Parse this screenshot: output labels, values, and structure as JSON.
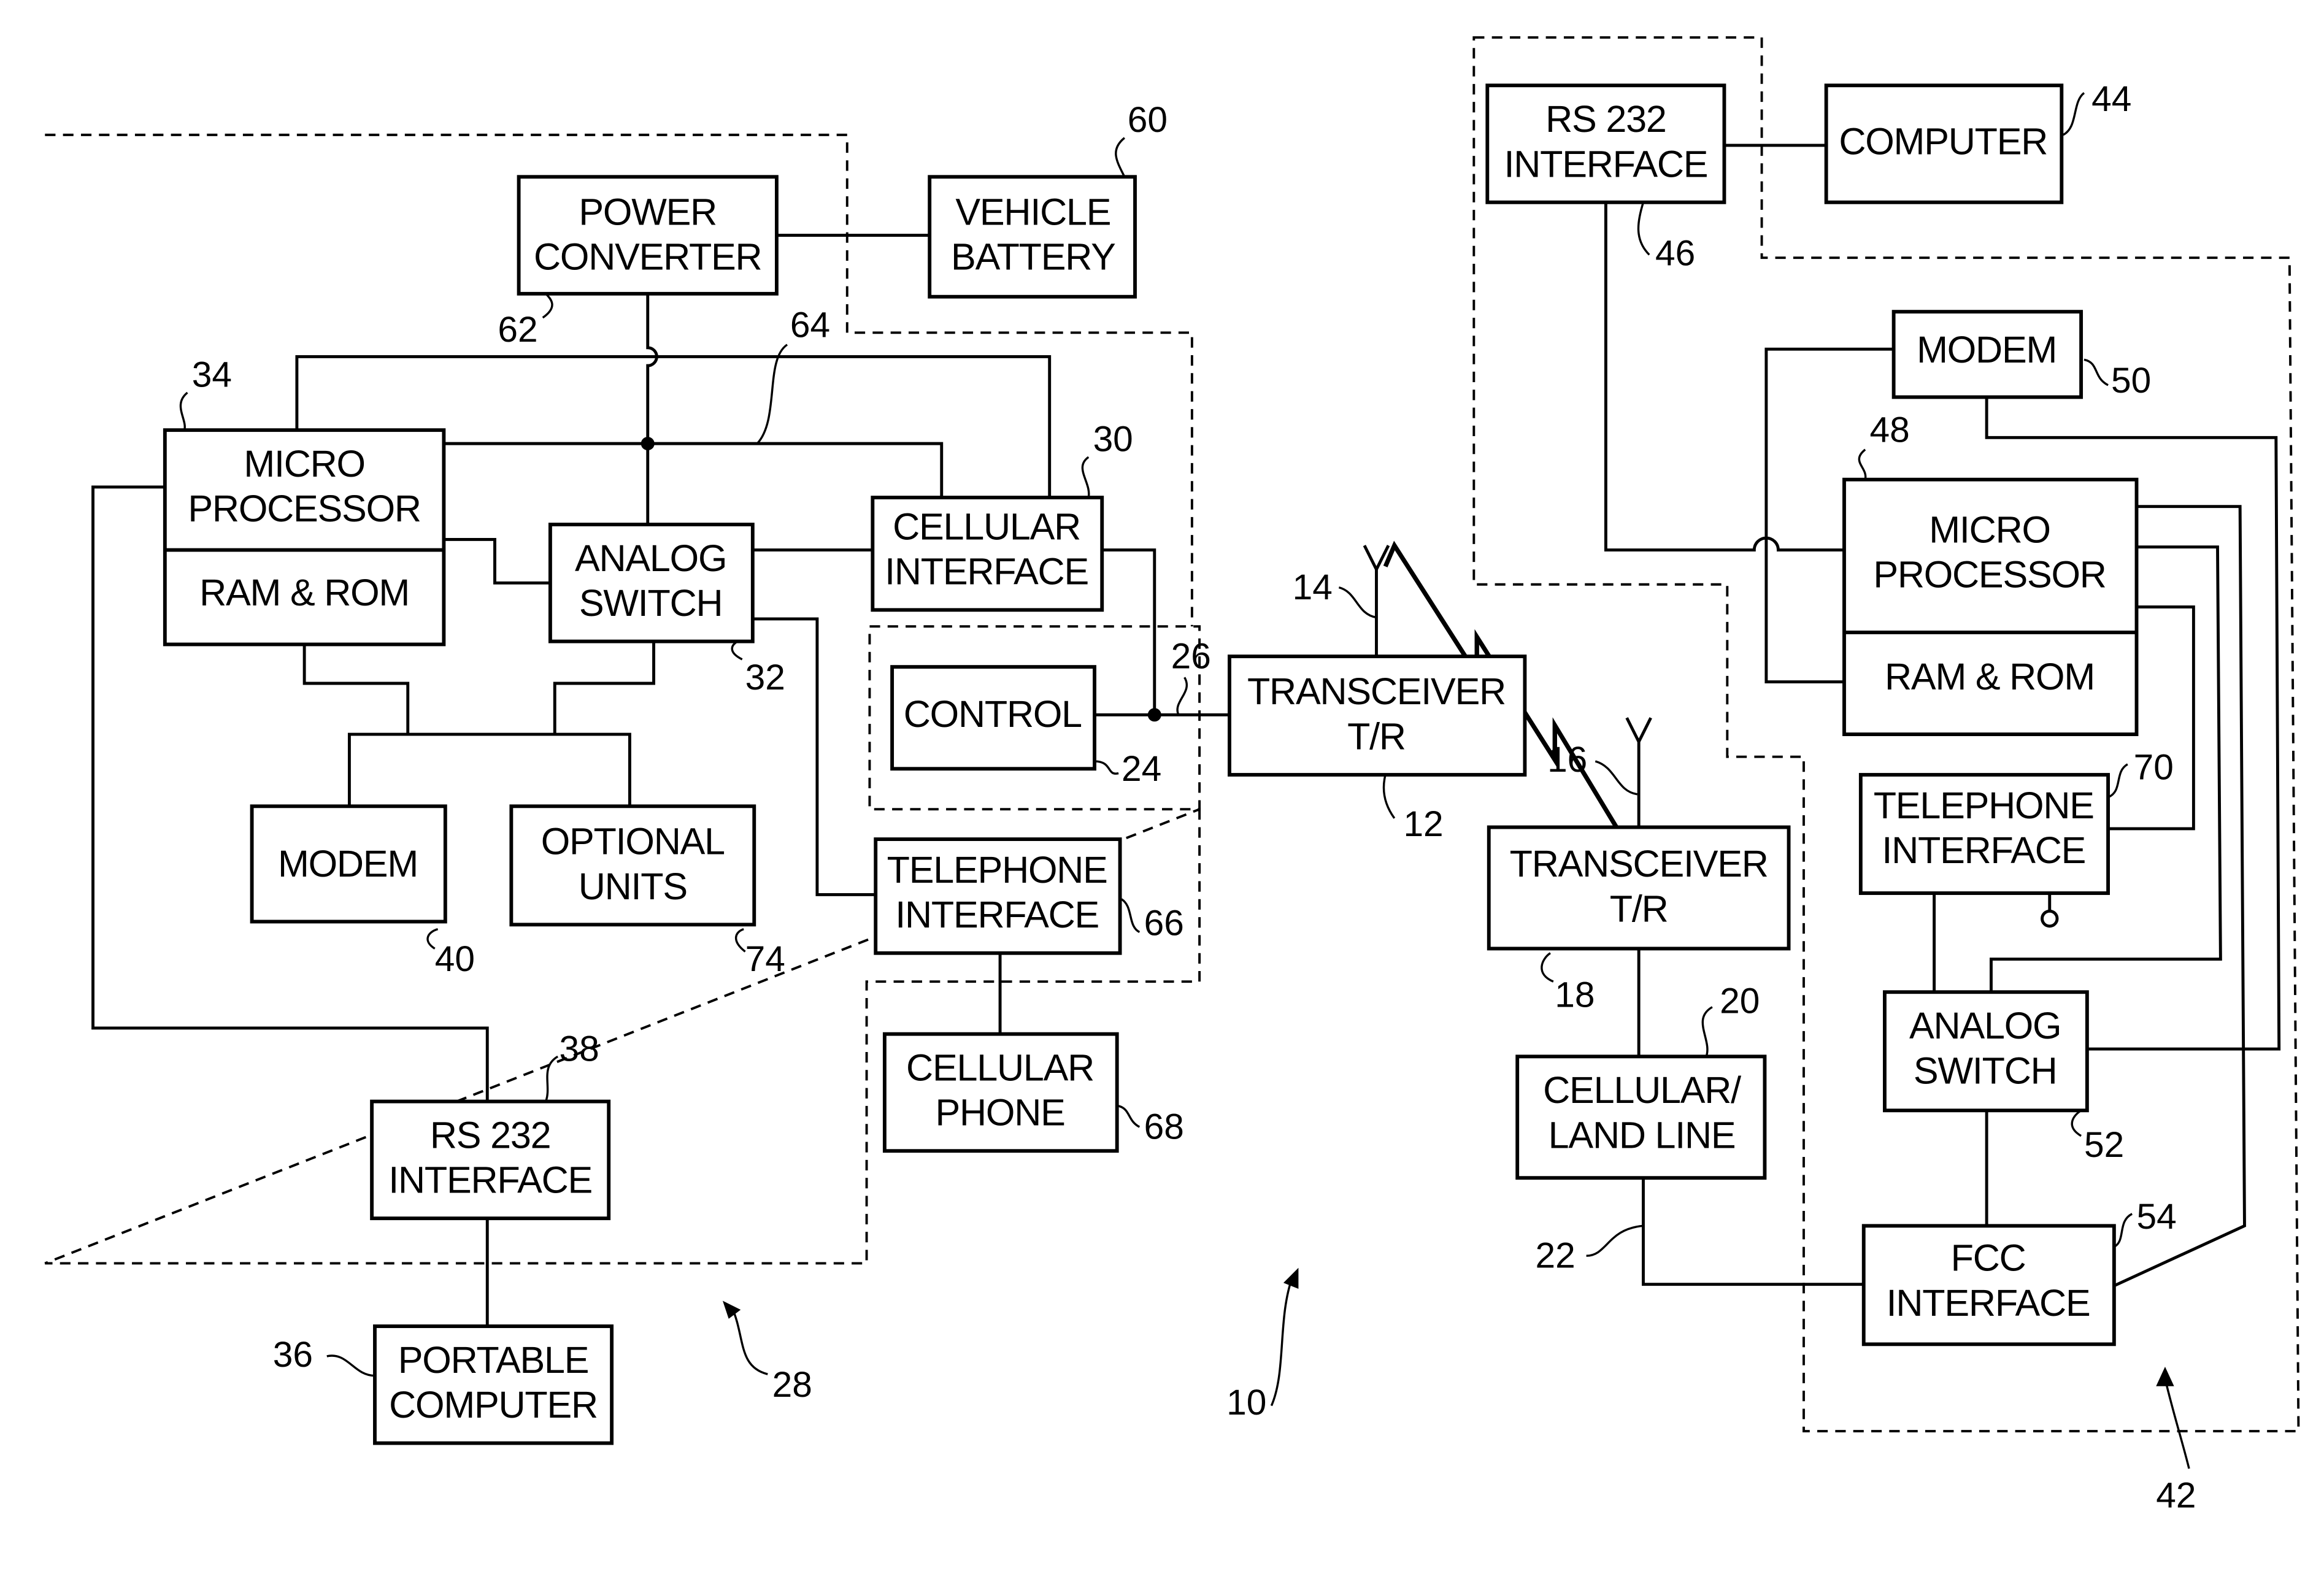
{
  "figure": {
    "reference": "10",
    "groups": [
      {
        "id": "mobile-unit",
        "ref": "28"
      },
      {
        "id": "base-unit",
        "ref": "42"
      }
    ],
    "blocks": [
      {
        "id": "power-converter",
        "lines": [
          "POWER",
          "CONVERTER"
        ],
        "ref": "62"
      },
      {
        "id": "vehicle-battery",
        "lines": [
          "VEHICLE",
          "BATTERY"
        ],
        "ref": "60"
      },
      {
        "id": "micro-processor-left",
        "lines": [
          "MICRO",
          "PROCESSOR"
        ],
        "sub": "RAM & ROM",
        "ref": "34"
      },
      {
        "id": "analog-switch-left",
        "lines": [
          "ANALOG",
          "SWITCH"
        ],
        "ref": "32"
      },
      {
        "id": "cellular-interface",
        "lines": [
          "CELLULAR",
          "INTERFACE"
        ],
        "ref": "30"
      },
      {
        "id": "control",
        "lines": [
          "CONTROL"
        ],
        "ref": "24"
      },
      {
        "id": "transceiver-left",
        "lines": [
          "TRANSCEIVER",
          "T/R"
        ],
        "ref": "12"
      },
      {
        "id": "modem-left",
        "lines": [
          "MODEM"
        ],
        "ref": "40"
      },
      {
        "id": "optional-units",
        "lines": [
          "OPTIONAL",
          "UNITS"
        ],
        "ref": "74"
      },
      {
        "id": "telephone-interface-left",
        "lines": [
          "TELEPHONE",
          "INTERFACE"
        ],
        "ref": "66"
      },
      {
        "id": "cellular-phone",
        "lines": [
          "CELLULAR",
          "PHONE"
        ],
        "ref": "68"
      },
      {
        "id": "rs232-left",
        "lines": [
          "RS 232",
          "INTERFACE"
        ],
        "ref": "38"
      },
      {
        "id": "portable-computer",
        "lines": [
          "PORTABLE",
          "COMPUTER"
        ],
        "ref": "36"
      },
      {
        "id": "rs232-right",
        "lines": [
          "RS 232",
          "INTERFACE"
        ],
        "ref": "46"
      },
      {
        "id": "computer",
        "lines": [
          "COMPUTER"
        ],
        "ref": "44"
      },
      {
        "id": "modem-right",
        "lines": [
          "MODEM"
        ],
        "ref": "50"
      },
      {
        "id": "micro-processor-right",
        "lines": [
          "MICRO",
          "PROCESSOR"
        ],
        "sub": "RAM & ROM",
        "ref": "48"
      },
      {
        "id": "telephone-interface-right",
        "lines": [
          "TELEPHONE",
          "INTERFACE"
        ],
        "ref": "70"
      },
      {
        "id": "analog-switch-right",
        "lines": [
          "ANALOG",
          "SWITCH"
        ],
        "ref": "52"
      },
      {
        "id": "fcc-interface",
        "lines": [
          "FCC",
          "INTERFACE"
        ],
        "ref": "54"
      },
      {
        "id": "transceiver-right",
        "lines": [
          "TRANSCEIVER",
          "T/R"
        ],
        "ref": "18"
      },
      {
        "id": "cellular-land-line",
        "lines": [
          "CELLULAR/",
          "LAND LINE"
        ],
        "ref": "20"
      }
    ],
    "refs": {
      "bus": "64",
      "control_line": "26",
      "antenna_left": "14",
      "antenna_right": "16",
      "land_line": "22"
    }
  }
}
